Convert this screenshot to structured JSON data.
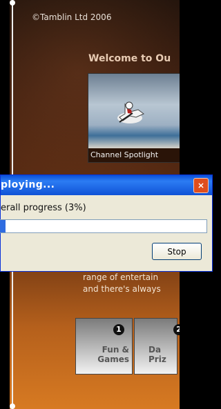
{
  "background": {
    "copyright": "©Tamblin Ltd 2006",
    "welcome": "Welcome to Ou",
    "spotlight_caption": "Channel Spotlight",
    "body_lines": [
      "range of entertain",
      "and there's always"
    ],
    "tiles": [
      {
        "number": "1",
        "title": "Fun & Games"
      },
      {
        "number": "2",
        "title": "Da Priz"
      }
    ]
  },
  "dialog": {
    "title": "ploying...",
    "progress_label": "erall progress (3%)",
    "progress_value": 0.03,
    "stop_label": "Stop",
    "accent_color": "#0a4fd8"
  },
  "icons": {
    "close": "close-icon",
    "spotlight": "kitesurfer-image"
  }
}
